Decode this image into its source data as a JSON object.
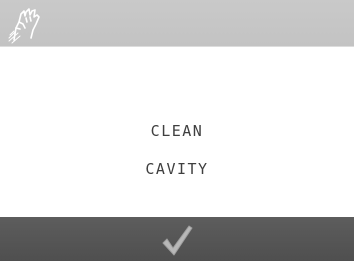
{
  "header": {
    "icon": "clean-hand-icon"
  },
  "message": {
    "line1": "CLEAN",
    "line2": "CAVITY"
  },
  "footer": {
    "confirm_icon": "checkmark-icon"
  },
  "colors": {
    "header_bg": "#c6c6c6",
    "body_bg": "#ffffff",
    "footer_bg": "#565656",
    "text": "#3f3f3f",
    "checkmark": "#b8b8b8"
  }
}
